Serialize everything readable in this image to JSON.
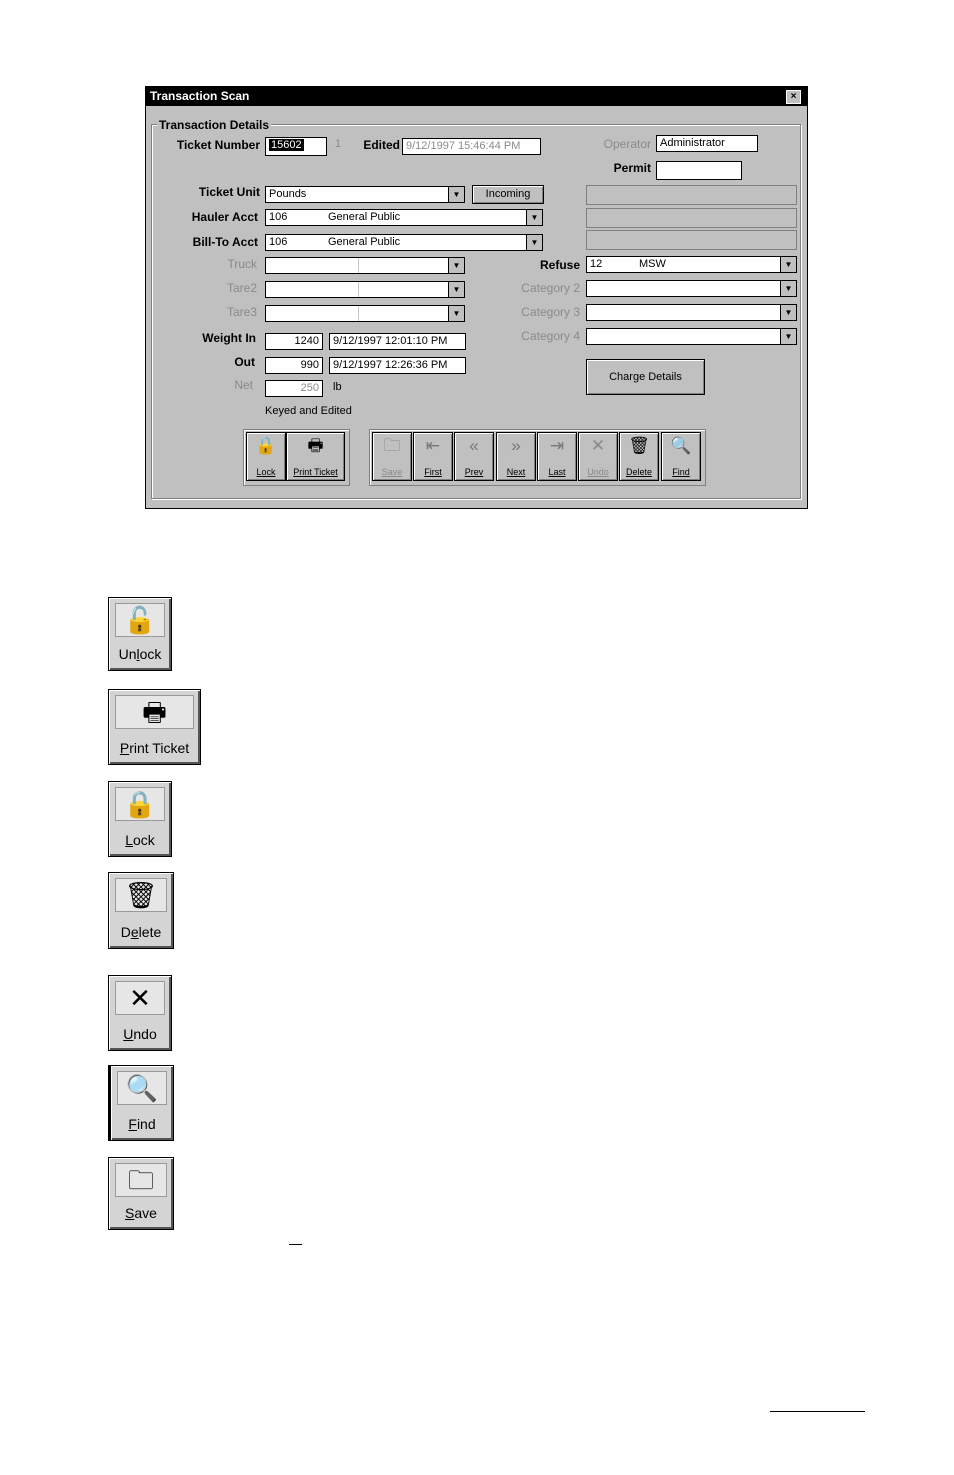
{
  "window": {
    "title": "Transaction Scan",
    "close": "×",
    "group": "Transaction Details"
  },
  "labels": {
    "ticket_number": "Ticket Number",
    "edited": "Edited",
    "operator": "Operator",
    "permit": "Permit",
    "ticket_unit": "Ticket Unit",
    "hauler_acct": "Hauler Acct",
    "bill_to_acct": "Bill-To Acct",
    "truck": "Truck",
    "tare2": "Tare2",
    "tare3": "Tare3",
    "refuse": "Refuse",
    "category2": "Category 2",
    "category3": "Category 3",
    "category4": "Category 4",
    "weight_in": "Weight In",
    "out": "Out",
    "net": "Net",
    "unit_lb": "lb",
    "keyed_note": "Keyed and Edited"
  },
  "fields": {
    "ticket_number": "15602",
    "ticket_suffix": "1",
    "edited": "9/12/1997 15:46:44 PM",
    "operator": "Administrator",
    "permit": "",
    "ticket_unit": "Pounds",
    "incoming_button": "Incoming",
    "hauler_code": "106",
    "hauler_name": "General Public",
    "billto_code": "106",
    "billto_name": "General Public",
    "refuse_code": "12",
    "refuse_name": "MSW",
    "weight_in": "1240",
    "weight_in_time": "9/12/1997 12:01:10 PM",
    "out": "990",
    "out_time": "9/12/1997 12:26:36 PM",
    "net": "250",
    "charge_details": "Charge Details",
    "dropdown_glyph": "▼"
  },
  "toolbar": {
    "lock": {
      "label": "Lock",
      "icon": "lock-icon",
      "glyph": "🔒"
    },
    "print": {
      "label": "Print Ticket",
      "icon": "printer-icon",
      "glyph": "🖶"
    },
    "save": {
      "label": "Save",
      "icon": "save-icon",
      "glyph": "🗀"
    },
    "first": {
      "label": "First",
      "icon": "first-icon",
      "glyph": "⇤"
    },
    "prev": {
      "label": "Prev",
      "icon": "prev-icon",
      "glyph": "«"
    },
    "next": {
      "label": "Next",
      "icon": "next-icon",
      "glyph": "»"
    },
    "last": {
      "label": "Last",
      "icon": "last-icon",
      "glyph": "⇥"
    },
    "undo": {
      "label": "Undo",
      "icon": "undo-icon",
      "glyph": "✕"
    },
    "delete": {
      "label": "Delete",
      "icon": "trash-icon",
      "glyph": "🗑"
    },
    "find": {
      "label": "Find",
      "icon": "magnifier-icon",
      "glyph": "🔍"
    }
  },
  "legend": {
    "unlock": {
      "pre": "Un",
      "u": "l",
      "post": "ock",
      "glyph": "🔓",
      "icon": "unlock-icon"
    },
    "print": {
      "pre": "",
      "u": "P",
      "post": "rint Ticket",
      "glyph": "🖶",
      "icon": "printer-icon"
    },
    "lock": {
      "pre": "",
      "u": "L",
      "post": "ock",
      "glyph": "🔒",
      "icon": "lock-icon"
    },
    "delete": {
      "pre": "D",
      "u": "e",
      "post": "lete",
      "glyph": "🗑",
      "icon": "trash-icon"
    },
    "undo": {
      "pre": "",
      "u": "U",
      "post": "ndo",
      "glyph": "✕",
      "icon": "undo-icon"
    },
    "find": {
      "pre": "",
      "u": "F",
      "post": "ind",
      "glyph": "🔍",
      "icon": "magnifier-icon"
    },
    "save": {
      "pre": "",
      "u": "S",
      "post": "ave",
      "glyph": "🗀",
      "icon": "save-icon"
    }
  }
}
